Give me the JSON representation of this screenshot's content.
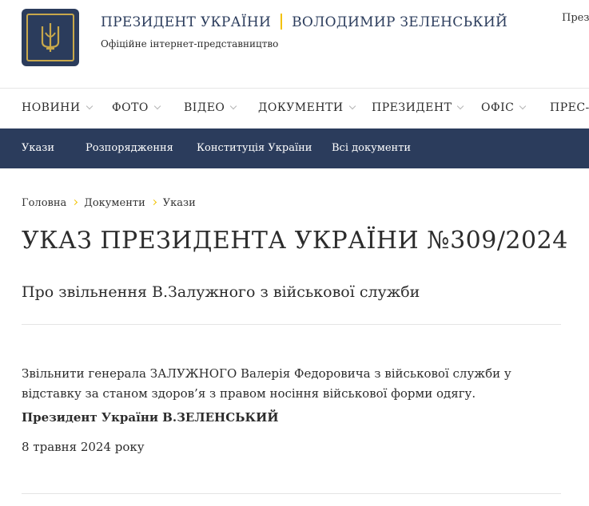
{
  "header": {
    "title_left": "ПРЕЗИДЕНТ УКРАЇНИ",
    "title_right": "ВОЛОДИМИР ЗЕЛЕНСЬКИЙ",
    "subtitle": "Офіційне інтернет-представництво",
    "top_right": "Прези"
  },
  "main_nav": [
    "НОВИНИ",
    "ФОТО",
    "ВІДЕО",
    "ДОКУМЕНТИ",
    "ПРЕЗИДЕНТ",
    "ОФІС",
    "ПРЕС-Ц"
  ],
  "sub_nav": [
    "Укази",
    "Розпорядження",
    "Конституція України",
    "Всі документи"
  ],
  "breadcrumb": [
    "Головна",
    "Документи",
    "Укази"
  ],
  "document": {
    "title": "УКАЗ ПРЕЗИДЕНТА УКРАЇНИ №309/2024",
    "subtitle": "Про звільнення В.Залужного з військової служби",
    "body": "Звільнити генерала ЗАЛУЖНОГО Валерія Федоровича з військової служби у відставку за станом здоров’я з правом носіння військової форми одягу.",
    "signature": "Президент України В.ЗЕЛЕНСЬКИЙ",
    "date": "8 травня 2024 року"
  },
  "colors": {
    "navy": "#2b3c5c",
    "gold": "#f2c200"
  }
}
